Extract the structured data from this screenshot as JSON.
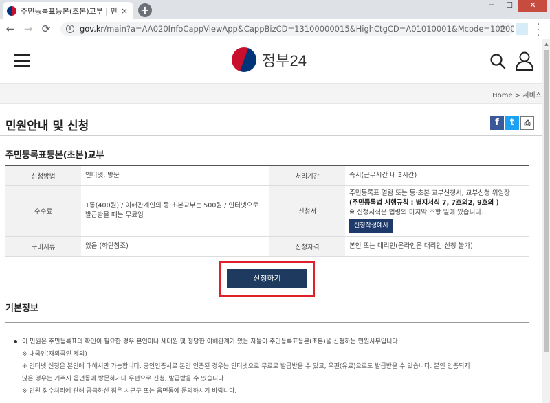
{
  "browser": {
    "tab_title": "주민등록표등본(초본)교부 | 민원",
    "tab_close": "×",
    "new_tab": "+",
    "window_min": "─",
    "window_max": "☐",
    "window_close": "✕",
    "back": "←",
    "forward": "→",
    "reload": "⟳",
    "url_host": "gov.kr",
    "url_path": "/main?a=AA020InfoCappViewApp&CappBizCD=13100000015&HighCtgCD=A01010001&Mcode=10200",
    "star": "☆"
  },
  "header": {
    "logo_text": "정부24"
  },
  "breadcrumb": "Home  >  서비스",
  "page_title": "민원안내 및 신청",
  "share": {
    "facebook": "f",
    "twitter": "t",
    "print": "⎙"
  },
  "service_title": "주민등록표등본(초본)교부",
  "table": {
    "method_label": "신청방법",
    "method_value": "인터넷, 방문",
    "period_label": "처리기간",
    "period_value": "즉시(근무시간 내 3시간)",
    "fee_label": "수수료",
    "fee_value": "1통(400원) / 이해관계인의 등·초본교부는 500원 / 인터넷으로 발급받을 때는 무료임",
    "form_label": "신청서",
    "form_line1": "주민등록표 열람 또는 등·초본 교부신청서, 교부신청 위임장",
    "form_line2": "(주민등록법 시행규칙 : 별지서식 7, 7호의2, 9호의 )",
    "form_line3": "※ 신청서식은 법령의 마지막 조항 밑에 있습니다.",
    "form_example_button": "신청작성예시",
    "docs_label": "구비서류",
    "docs_value": "있음 (하단참조)",
    "qualification_label": "신청자격",
    "qualification_value": "본인 또는 대리인(온라인은 대리인 신청 불가)"
  },
  "apply_button": "신청하기",
  "basic_info": {
    "title": "기본정보",
    "line1": "이 민원은 주민등록표의 확인이 필요한 경우 본인이나 세대원 및 정당한 이해관계가 있는 자들이 주민등록표등본(초본)을 신청하는 민원사무입니다.",
    "line2": "※ 내국인(재외국인 제외)",
    "line3": "※ 인터넷 신청은 본인에 대해서만 가능합니다. 공인인증서로 본인 인증된 경우는 인터넷으로 무료로 발급받을 수 있고, 우편(유료)으로도 발급받을 수 있습니다. 본인 인증되지",
    "line4": "않은 경우는 거주지 읍면동에 방문하거나 우편으로 신청, 발급받을 수 있습니다.",
    "line5": "※ 민원 접수처리에 관해 궁금하신 점은 시군구 또는 읍면동에 문의하시기 바랍니다."
  },
  "colors": {
    "apply_button_bg": "#1e3a5f",
    "highlight_border": "#e0202a",
    "facebook": "#3b5998",
    "twitter": "#1da1f2"
  }
}
